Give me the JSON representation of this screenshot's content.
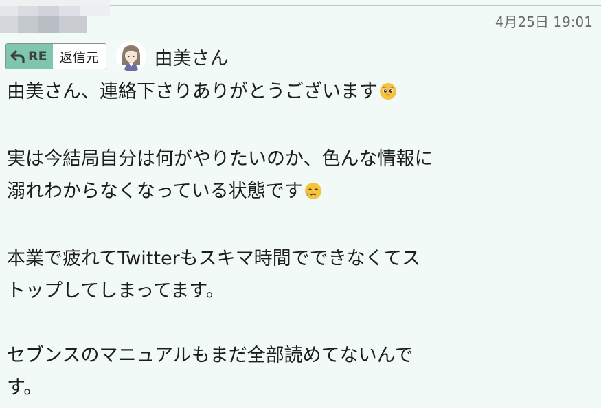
{
  "message": {
    "timestamp": "4月25日 19:01",
    "reply_badge": {
      "re_label": "RE",
      "source_label": "返信元"
    },
    "sender_name": "由美さん",
    "lines": [
      "由美さん、連絡下さりありがとうございます",
      "実は今結局自分は何がやりたいのか、色んな情報に",
      "溺れわからなくなっている状態です",
      "本業で疲れてTwitterもスキマ時間でできなくてス",
      "トップしてしまってます。",
      "セブンスのマニュアルもまだ全部読めてないんで",
      "す。"
    ],
    "emojis": {
      "line1": "pleading-face-icon",
      "line3": "sad-sweat-face-icon"
    }
  },
  "colors": {
    "background": "#f1faf7",
    "re_accent": "#7ec6ad",
    "timestamp": "#6c6c6c"
  }
}
